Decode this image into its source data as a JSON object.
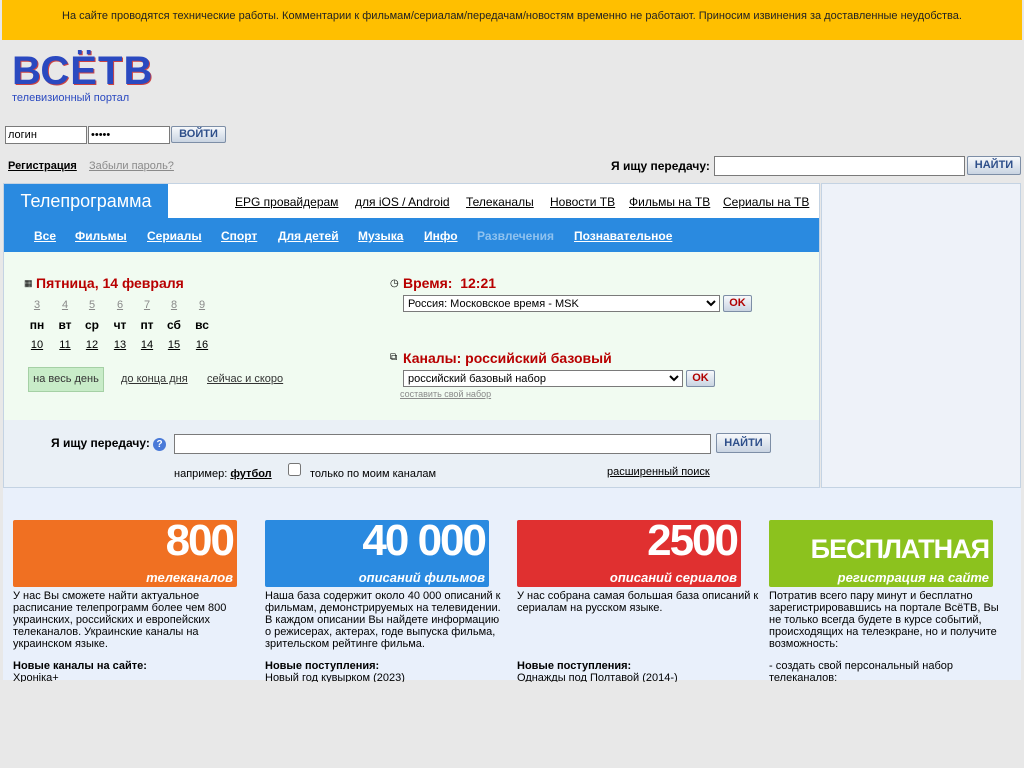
{
  "notice": "На сайте проводятся технические работы. Комментарии к фильмам/сериалам/передачам/новостям временно не работают. Приносим извинения за доставленные неудобства.",
  "logo": {
    "name": "ВСЁТВ",
    "tagline": "телевизионный портал"
  },
  "login": {
    "login_value": "логин",
    "password_value": "•••••",
    "submit": "ВОЙТИ",
    "register": "Регистрация",
    "forgot": "Забыли пароль?"
  },
  "header_search": {
    "label": "Я ищу передачу:",
    "value": "",
    "button": "НАЙТИ"
  },
  "nav": {
    "active_tab": "Телепрограмма",
    "links": [
      "EPG провайдерам",
      "для iOS / Android",
      "Телеканалы",
      "Новости ТВ",
      "Фильмы на ТВ",
      "Сериалы на ТВ"
    ]
  },
  "categories": [
    "Все",
    "Фильмы",
    "Сериалы",
    "Спорт",
    "Для детей",
    "Музыка",
    "Инфо",
    "Развлечения",
    "Познавательное"
  ],
  "date": {
    "title": "Пятница, 14 февраля",
    "prev_week": [
      "3",
      "4",
      "5",
      "6",
      "7",
      "8",
      "9"
    ],
    "weekdays": [
      "пн",
      "вт",
      "ср",
      "чт",
      "пт",
      "сб",
      "вс"
    ],
    "current_week": [
      "10",
      "11",
      "12",
      "13",
      "14",
      "15",
      "16"
    ],
    "filters": [
      "на весь день",
      "до конца дня",
      "сейчас и скоро"
    ]
  },
  "time": {
    "title": "Время:",
    "value": "12:21",
    "zone": "Россия: Московское время - MSK",
    "ok": "OK"
  },
  "channels": {
    "title": "Каналы: российский базовый",
    "set": "российский базовый набор",
    "ok": "OK",
    "custom_link": "составить свой набор"
  },
  "search": {
    "label": "Я ищу передачу:",
    "help": "?",
    "value": "",
    "button": "НАЙТИ",
    "example_prefix": "например:",
    "example": "футбол",
    "only_mine": "только по моим каналам",
    "advanced": "расширенный поиск"
  },
  "features": [
    {
      "big": "800",
      "sub": "телеканалов",
      "color": "#f07022",
      "text": "У нас Вы сможете найти актуальное расписание телепрограмм более чем 800 украинских, российских и европейских телеканалов. Украинские каналы на украинском языке.",
      "head": "Новые каналы на сайте:",
      "item": "Хроніка+"
    },
    {
      "big": "40 000",
      "sub": "описаний фильмов",
      "color": "#2a8ae0",
      "text": "Наша база содержит около 40 000 описаний к фильмам, демонстрируемых на телевидении. В каждом описании Вы найдете информацию о режисерах, актерах, годе выпуска фильма, зрительском рейтинге фильма.",
      "head": "Новые поступления:",
      "item": "Новый год кувырком (2023)"
    },
    {
      "big": "2500",
      "sub": "описаний сериалов",
      "color": "#e03030",
      "text": "У нас собрана самая большая база описаний к сериалам на русском языке.",
      "head": "Новые поступления:",
      "item": "Однажды под Полтавой (2014-)"
    },
    {
      "big": "БЕСПЛАТНАЯ",
      "sub": "регистрация на сайте",
      "color": "#8cc21e",
      "text": "Потратив всего пару минут и бесплатно зарегистрировавшись на портале ВсёТВ, Вы не только всегда будете в курсе событий, происходящих на телеэкране, но и получите возможность:",
      "head": "",
      "item": "- создать свой персональный набор телеканалов:"
    }
  ]
}
